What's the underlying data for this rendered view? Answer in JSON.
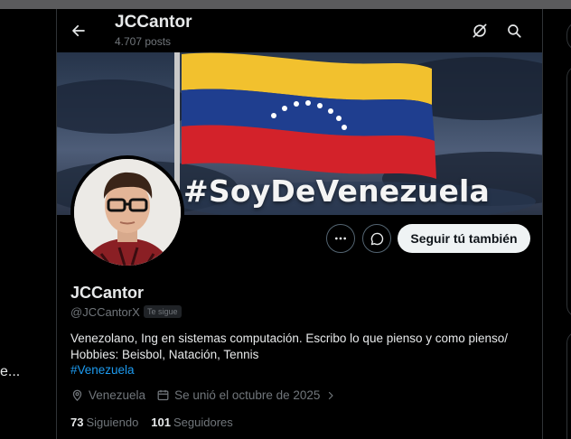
{
  "header": {
    "name": "JCCantor",
    "posts": "4.707 posts"
  },
  "banner": {
    "hashtag": "#SoyDeVenezuela"
  },
  "profile": {
    "display_name": "JCCantor",
    "handle": "@JCCantorX",
    "follows_you": "Te sigue",
    "bio_line1": "Venezolano, Ing en sistemas computación. Escribo lo que pienso y como pienso/",
    "bio_line2": "Hobbies:  Beisbol, Natación, Tennis",
    "bio_link": "#Venezuela",
    "location": "Venezuela",
    "joined": "Se unió el octubre de 2025",
    "following_count": "73",
    "following_label": "Siguiendo",
    "followers_count": "101",
    "followers_label": "Seguidores"
  },
  "actions": {
    "follow_label": "Seguir tú también"
  },
  "left_col": {
    "truncated_text": "e..."
  },
  "icons": {
    "back": "arrow-left-icon",
    "grok": "grok-icon",
    "search": "search-icon",
    "more": "more-icon",
    "message": "message-icon",
    "location": "location-pin-icon",
    "calendar": "calendar-icon",
    "chevron": "chevron-right-icon"
  },
  "colors": {
    "background": "#000000",
    "text": "#e7e9ea",
    "muted": "#71767b",
    "link": "#1d9bf0",
    "button_bg": "#eff3f4"
  }
}
